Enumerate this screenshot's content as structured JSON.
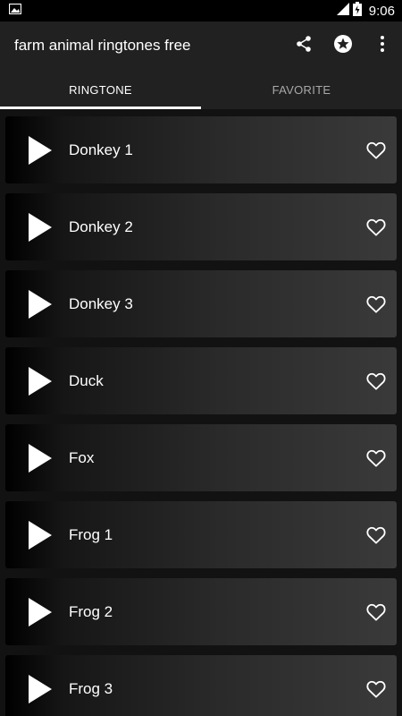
{
  "status_bar": {
    "time": "9:06",
    "icons": [
      "image-notification-icon",
      "signal-icon",
      "battery-icon"
    ]
  },
  "app_bar": {
    "title": "farm animal ringtones free",
    "actions": [
      "share-icon",
      "star-icon",
      "more-vert-icon"
    ]
  },
  "tabs": [
    {
      "label": "RINGTONE",
      "active": true
    },
    {
      "label": "FAVORITE",
      "active": false
    }
  ],
  "ringtones": [
    {
      "label": "Donkey 1"
    },
    {
      "label": "Donkey 2"
    },
    {
      "label": "Donkey 3"
    },
    {
      "label": "Duck"
    },
    {
      "label": "Fox"
    },
    {
      "label": "Frog 1"
    },
    {
      "label": "Frog 2"
    },
    {
      "label": "Frog 3"
    }
  ],
  "colors": {
    "app_bar": "#212121",
    "status_bar": "#000000",
    "tab_indicator": "#ffffff",
    "background": "#121212"
  }
}
